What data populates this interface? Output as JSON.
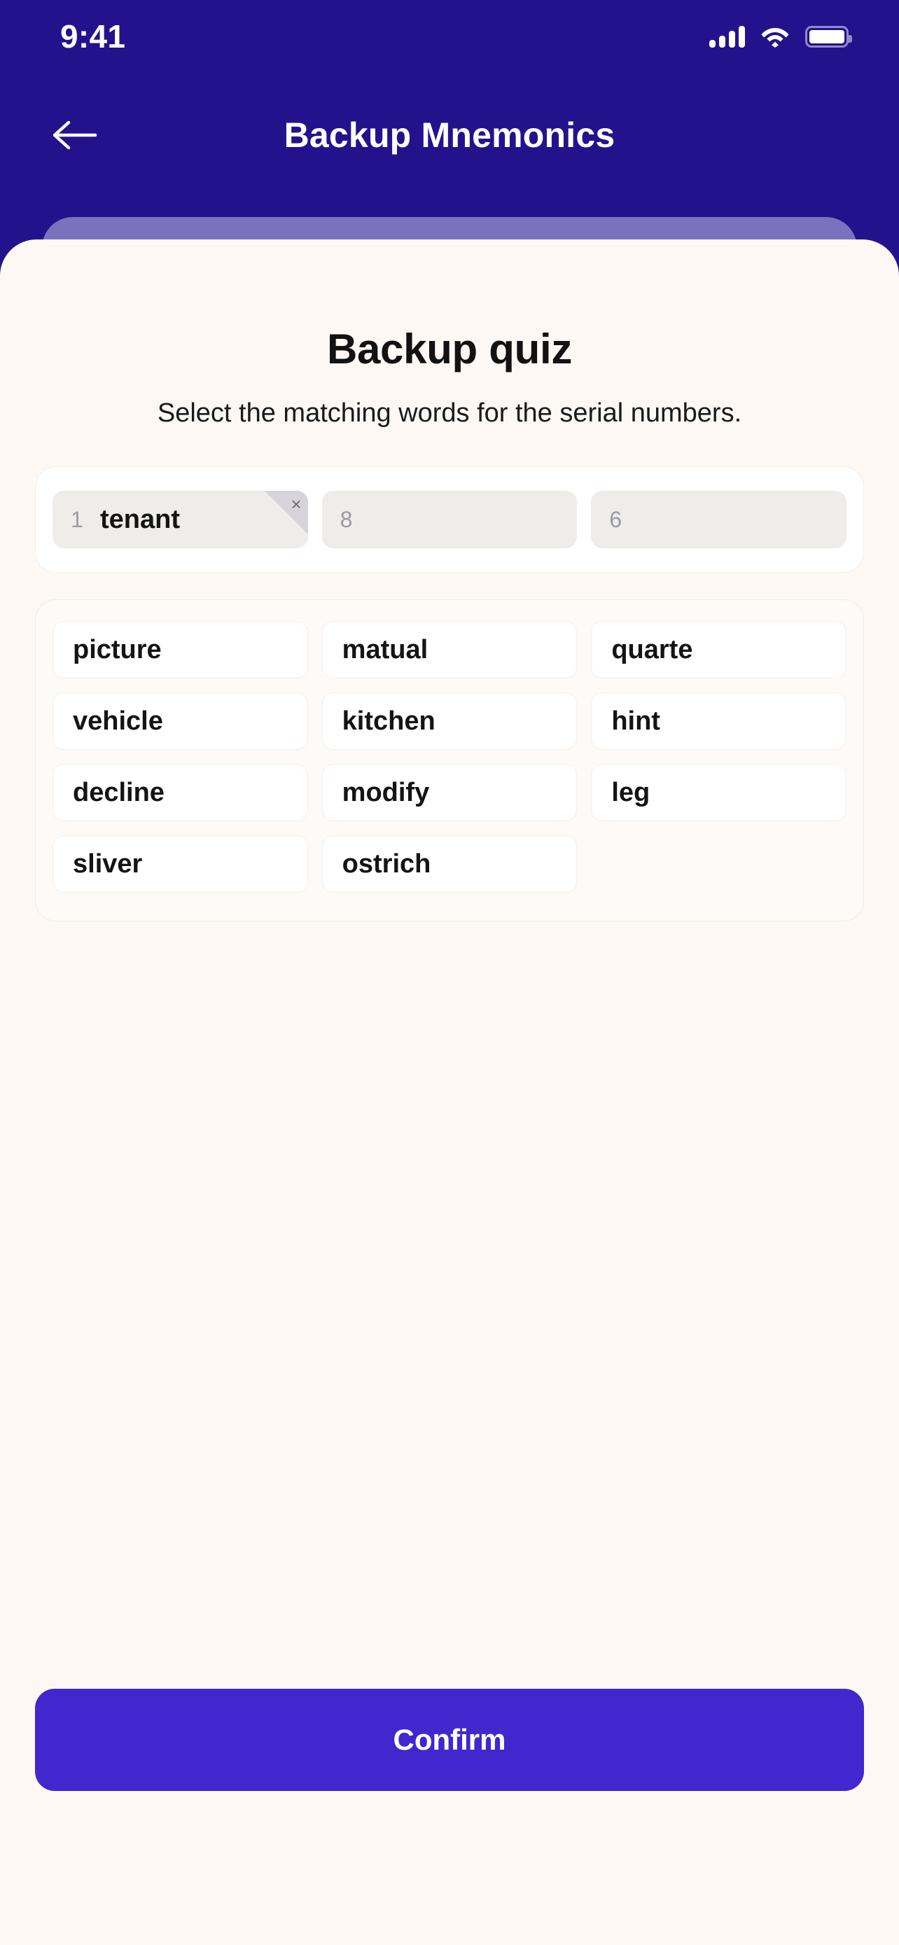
{
  "status_bar": {
    "time": "9:41",
    "signal_icon": "signal-bars-icon",
    "wifi_icon": "wifi-icon",
    "battery_icon": "battery-full-icon"
  },
  "header": {
    "title": "Backup Mnemonics",
    "back_icon": "arrow-left-icon",
    "background_color": "#24128C",
    "peek_card_color": "#7B72BE"
  },
  "main": {
    "title": "Backup quiz",
    "subtitle": "Select the matching words for the serial numbers.",
    "background_color": "#FDF8F4"
  },
  "slots": [
    {
      "index": "1",
      "word": "tenant",
      "filled": true,
      "remove_icon": "close-icon",
      "remove_label": "×"
    },
    {
      "index": "8",
      "word": "",
      "filled": false
    },
    {
      "index": "6",
      "word": "",
      "filled": false
    }
  ],
  "word_bank": {
    "words": [
      "picture",
      "matual",
      "quarte",
      "vehicle",
      "kitchen",
      "hint",
      "decline",
      "modify",
      "leg",
      "sliver",
      "ostrich"
    ]
  },
  "footer": {
    "confirm_label": "Confirm",
    "confirm_color": "#4226CE"
  }
}
